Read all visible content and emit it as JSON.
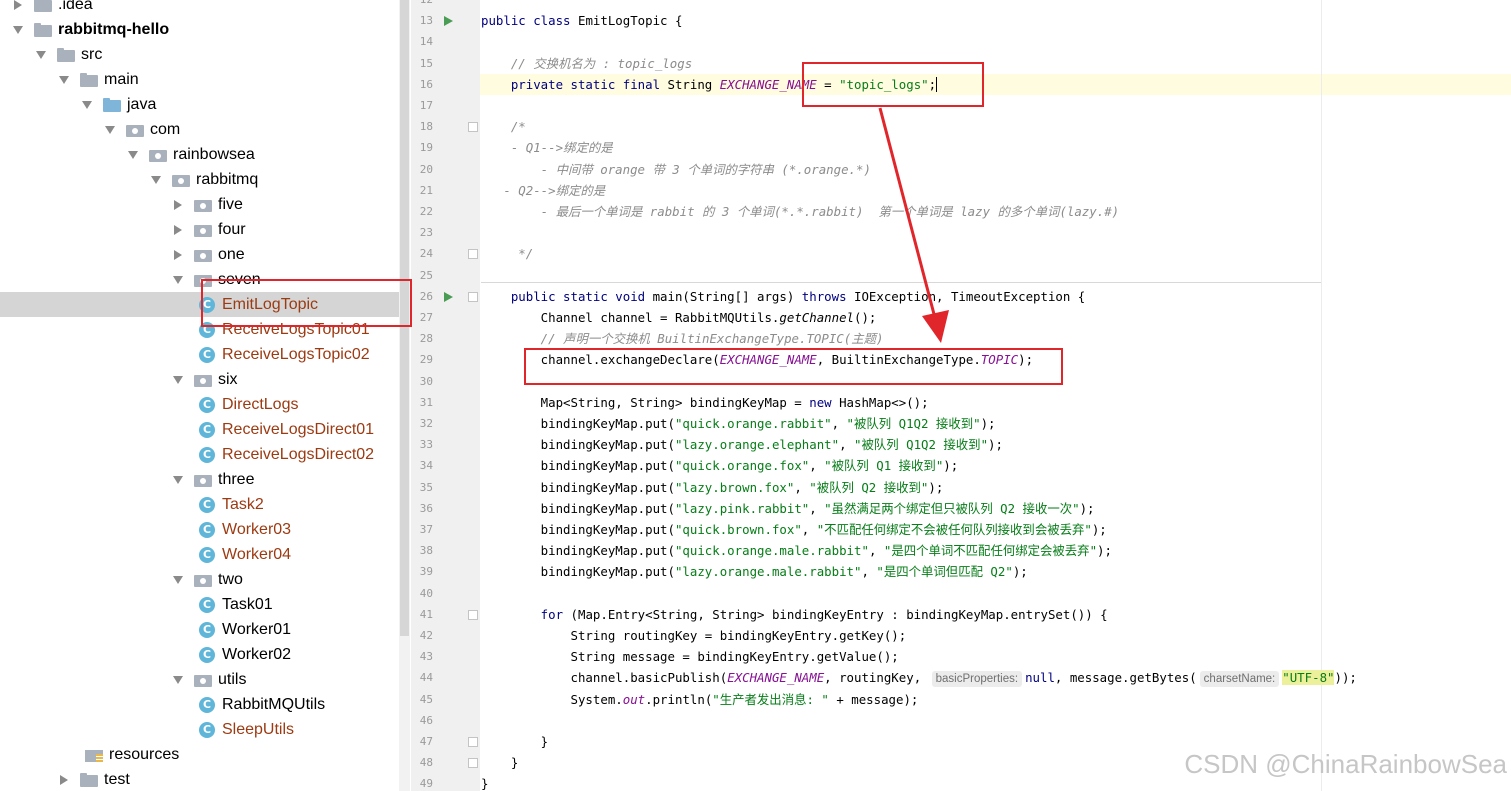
{
  "tree": {
    "items": [
      {
        "label": ".idea",
        "kind": "folder",
        "arrow": "right",
        "indent": 0
      },
      {
        "label": "rabbitmq-hello",
        "kind": "folder",
        "arrow": "down",
        "indent": 0,
        "bold": true
      },
      {
        "label": "src",
        "kind": "folder",
        "arrow": "down",
        "indent": 1
      },
      {
        "label": "main",
        "kind": "folder",
        "arrow": "down",
        "indent": 2
      },
      {
        "label": "java",
        "kind": "folder-blue",
        "arrow": "down",
        "indent": 3
      },
      {
        "label": "com",
        "kind": "package",
        "arrow": "down",
        "indent": 4
      },
      {
        "label": "rainbowsea",
        "kind": "package",
        "arrow": "down",
        "indent": 5
      },
      {
        "label": "rabbitmq",
        "kind": "package",
        "arrow": "down",
        "indent": 6
      },
      {
        "label": "five",
        "kind": "package",
        "arrow": "right",
        "indent": 7
      },
      {
        "label": "four",
        "kind": "package",
        "arrow": "right",
        "indent": 7
      },
      {
        "label": "one",
        "kind": "package",
        "arrow": "right",
        "indent": 7
      },
      {
        "label": "seven",
        "kind": "package",
        "arrow": "down",
        "indent": 7
      },
      {
        "label": "EmitLogTopic",
        "kind": "class",
        "indent": 8,
        "modified": true,
        "selected": true
      },
      {
        "label": "ReceiveLogsTopic01",
        "kind": "class",
        "indent": 8,
        "modified": true
      },
      {
        "label": "ReceiveLogsTopic02",
        "kind": "class",
        "indent": 8,
        "modified": true
      },
      {
        "label": "six",
        "kind": "package",
        "arrow": "down",
        "indent": 7
      },
      {
        "label": "DirectLogs",
        "kind": "class",
        "indent": 8,
        "modified": true
      },
      {
        "label": "ReceiveLogsDirect01",
        "kind": "class",
        "indent": 8,
        "modified": true
      },
      {
        "label": "ReceiveLogsDirect02",
        "kind": "class",
        "indent": 8,
        "modified": true
      },
      {
        "label": "three",
        "kind": "package",
        "arrow": "down",
        "indent": 7
      },
      {
        "label": "Task2",
        "kind": "class",
        "indent": 8,
        "modified": true
      },
      {
        "label": "Worker03",
        "kind": "class",
        "indent": 8,
        "modified": true
      },
      {
        "label": "Worker04",
        "kind": "class",
        "indent": 8,
        "modified": true
      },
      {
        "label": "two",
        "kind": "package",
        "arrow": "down",
        "indent": 7
      },
      {
        "label": "Task01",
        "kind": "class",
        "indent": 8
      },
      {
        "label": "Worker01",
        "kind": "class",
        "indent": 8
      },
      {
        "label": "Worker02",
        "kind": "class",
        "indent": 8
      },
      {
        "label": "utils",
        "kind": "package",
        "arrow": "down",
        "indent": 7
      },
      {
        "label": "RabbitMQUtils",
        "kind": "class",
        "indent": 8
      },
      {
        "label": "SleepUtils",
        "kind": "class",
        "indent": 8,
        "modified": true
      },
      {
        "label": "resources",
        "kind": "resources",
        "indent": 3
      },
      {
        "label": "test",
        "kind": "folder",
        "arrow": "right",
        "indent": 2
      }
    ]
  },
  "editor": {
    "line_numbers": [
      "12",
      "13",
      "14",
      "15",
      "16",
      "17",
      "18",
      "19",
      "20",
      "21",
      "22",
      "23",
      "24",
      "25",
      "26",
      "27",
      "28",
      "29",
      "30",
      "31",
      "32",
      "33",
      "34",
      "35",
      "36",
      "37",
      "38",
      "39",
      "40",
      "41",
      "42",
      "43",
      "44",
      "45",
      "46",
      "47",
      "48",
      "49"
    ],
    "lines": [
      [],
      [
        [
          "kw",
          "public class "
        ],
        [
          "",
          "EmitLogTopic {"
        ]
      ],
      [],
      [
        [
          "cmt",
          "    // 交换机名为 : topic_logs"
        ]
      ],
      [
        [
          "kw",
          "    private static final "
        ],
        [
          "",
          "String "
        ],
        [
          "fld",
          "EXCHANGE_NAME"
        ],
        [
          "",
          " = "
        ],
        [
          "str",
          "\"topic_logs\""
        ],
        [
          "",
          ";"
        ]
      ],
      [],
      [
        [
          "cmt",
          "    /*"
        ]
      ],
      [
        [
          "cmt",
          "    - Q1-->绑定的是"
        ]
      ],
      [
        [
          "cmt",
          "        - 中间带 orange 带 3 个单词的字符串 (*.orange.*)"
        ]
      ],
      [
        [
          "cmt",
          "   - Q2-->绑定的是"
        ]
      ],
      [
        [
          "cmt",
          "        - 最后一个单词是 rabbit 的 3 个单词(*.*.rabbit)  第一个单词是 lazy 的多个单词(lazy.#)"
        ]
      ],
      [],
      [
        [
          "cmt",
          "     */"
        ]
      ],
      [],
      [
        [
          "kw",
          "    public static void "
        ],
        [
          "",
          "main(String[] args) "
        ],
        [
          "kw",
          "throws "
        ],
        [
          "",
          "IOException, TimeoutException {"
        ]
      ],
      [
        [
          "",
          "        Channel channel = RabbitMQUtils."
        ],
        [
          "st",
          "getChannel"
        ],
        [
          "",
          "();"
        ]
      ],
      [
        [
          "cmt",
          "        // 声明一个交换机 BuiltinExchangeType.TOPIC(主题)"
        ]
      ],
      [
        [
          "",
          "        channel.exchangeDeclare("
        ],
        [
          "fld",
          "EXCHANGE_NAME"
        ],
        [
          "",
          ", BuiltinExchangeType."
        ],
        [
          "fld",
          "TOPIC"
        ],
        [
          "",
          ");"
        ]
      ],
      [],
      [
        [
          "",
          "        Map<String, String> bindingKeyMap = "
        ],
        [
          "kw",
          "new "
        ],
        [
          "",
          "HashMap<>();"
        ]
      ],
      [
        [
          "",
          "        bindingKeyMap.put("
        ],
        [
          "str",
          "\"quick.orange.rabbit\""
        ],
        [
          "",
          ", "
        ],
        [
          "str",
          "\"被队列 Q1Q2 接收到\""
        ],
        [
          "",
          ");"
        ]
      ],
      [
        [
          "",
          "        bindingKeyMap.put("
        ],
        [
          "str",
          "\"lazy.orange.elephant\""
        ],
        [
          "",
          ", "
        ],
        [
          "str",
          "\"被队列 Q1Q2 接收到\""
        ],
        [
          "",
          ");"
        ]
      ],
      [
        [
          "",
          "        bindingKeyMap.put("
        ],
        [
          "str",
          "\"quick.orange.fox\""
        ],
        [
          "",
          ", "
        ],
        [
          "str",
          "\"被队列 Q1 接收到\""
        ],
        [
          "",
          ");"
        ]
      ],
      [
        [
          "",
          "        bindingKeyMap.put("
        ],
        [
          "str",
          "\"lazy.brown.fox\""
        ],
        [
          "",
          ", "
        ],
        [
          "str",
          "\"被队列 Q2 接收到\""
        ],
        [
          "",
          ");"
        ]
      ],
      [
        [
          "",
          "        bindingKeyMap.put("
        ],
        [
          "str",
          "\"lazy.pink.rabbit\""
        ],
        [
          "",
          ", "
        ],
        [
          "str",
          "\"虽然满足两个绑定但只被队列 Q2 接收一次\""
        ],
        [
          "",
          ");"
        ]
      ],
      [
        [
          "",
          "        bindingKeyMap.put("
        ],
        [
          "str",
          "\"quick.brown.fox\""
        ],
        [
          "",
          ", "
        ],
        [
          "str",
          "\"不匹配任何绑定不会被任何队列接收到会被丢弃\""
        ],
        [
          "",
          ");"
        ]
      ],
      [
        [
          "",
          "        bindingKeyMap.put("
        ],
        [
          "str",
          "\"quick.orange.male.rabbit\""
        ],
        [
          "",
          ", "
        ],
        [
          "str",
          "\"是四个单词不匹配任何绑定会被丢弃\""
        ],
        [
          "",
          ");"
        ]
      ],
      [
        [
          "",
          "        bindingKeyMap.put("
        ],
        [
          "str",
          "\"lazy.orange.male.rabbit\""
        ],
        [
          "",
          ", "
        ],
        [
          "str",
          "\"是四个单词但匹配 Q2\""
        ],
        [
          "",
          ");"
        ]
      ],
      [],
      [
        [
          "kw",
          "        for "
        ],
        [
          "",
          "(Map.Entry<String, String> bindingKeyEntry : bindingKeyMap.entrySet()) {"
        ]
      ],
      [
        [
          "",
          "            String routingKey = bindingKeyEntry.getKey();"
        ]
      ],
      [
        [
          "",
          "            String message = bindingKeyEntry.getValue();"
        ]
      ],
      [
        [
          "",
          "            channel.basicPublish("
        ],
        [
          "fld",
          "EXCHANGE_NAME"
        ],
        [
          "",
          ", routingKey, "
        ],
        [
          "hint",
          "basicProperties:"
        ],
        [
          "kw",
          "null"
        ],
        [
          "",
          ", message.getBytes("
        ],
        [
          "hint",
          "charsetName:"
        ],
        [
          "strhl",
          "\"UTF-8\""
        ],
        [
          "",
          "));"
        ]
      ],
      [
        [
          "",
          "            System."
        ],
        [
          "fld",
          "out"
        ],
        [
          "",
          ".println("
        ],
        [
          "str",
          "\"生产者发出消息: \""
        ],
        [
          "",
          " + message);"
        ]
      ],
      [],
      [
        [
          "",
          "        }"
        ]
      ],
      [
        [
          "",
          "    }"
        ]
      ],
      [
        [
          "",
          "}"
        ]
      ]
    ]
  },
  "colors": {
    "annotation_red": "#e0262b",
    "keyword": "#000080",
    "string": "#067d17",
    "field": "#871094",
    "comment": "#8c8c8c"
  },
  "watermark": "CSDN @ChinaRainbowSea"
}
